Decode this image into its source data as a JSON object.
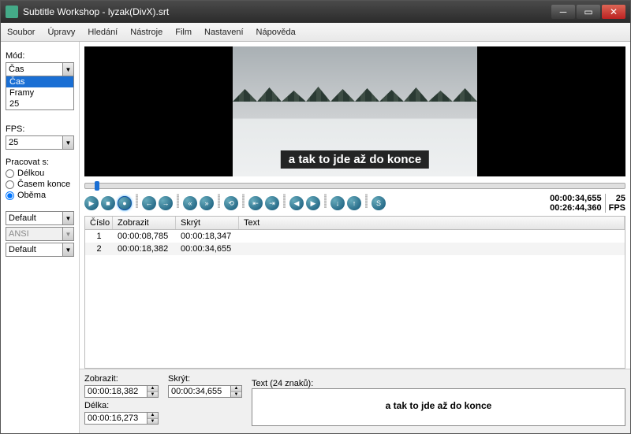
{
  "titlebar": {
    "title": "Subtitle Workshop - lyzak(DivX).srt"
  },
  "menu": {
    "file": "Soubor",
    "edit": "Úpravy",
    "search": "Hledání",
    "tools": "Nástroje",
    "film": "Film",
    "settings": "Nastavení",
    "help": "Nápověda"
  },
  "sidebar": {
    "mode_label": "Mód:",
    "mode_value": "Čas",
    "mode_options": {
      "cas": "Čas",
      "framy": "Framy",
      "fps25": "25"
    },
    "fps_label": "FPS:",
    "fps_value": "25",
    "work_label": "Pracovat s:",
    "r_delkou": "Délkou",
    "r_casem": "Časem konce",
    "r_obema": "Oběma",
    "default1": "Default",
    "ansi": "ANSI",
    "default2": "Default"
  },
  "video": {
    "subtitle": "a tak to jde až do konce"
  },
  "timedisp": {
    "current": "00:00:34,655",
    "total": "00:26:44,360",
    "fpsnum": "25",
    "fpslabel": "FPS"
  },
  "table": {
    "h_num": "Číslo",
    "h_show": "Zobrazit",
    "h_hide": "Skrýt",
    "h_text": "Text",
    "rows": [
      {
        "n": "1",
        "show": "00:00:08,785",
        "hide": "00:00:18,347"
      },
      {
        "n": "2",
        "show": "00:00:18,382",
        "hide": "00:00:34,655"
      }
    ]
  },
  "bottom": {
    "show_label": "Zobrazit:",
    "show_val": "00:00:18,382",
    "hide_label": "Skrýt:",
    "hide_val": "00:00:34,655",
    "len_label": "Délka:",
    "len_val": "00:00:16,273",
    "text_label": "Text (24 znaků):",
    "text_val": "a tak to jde až do konce"
  }
}
